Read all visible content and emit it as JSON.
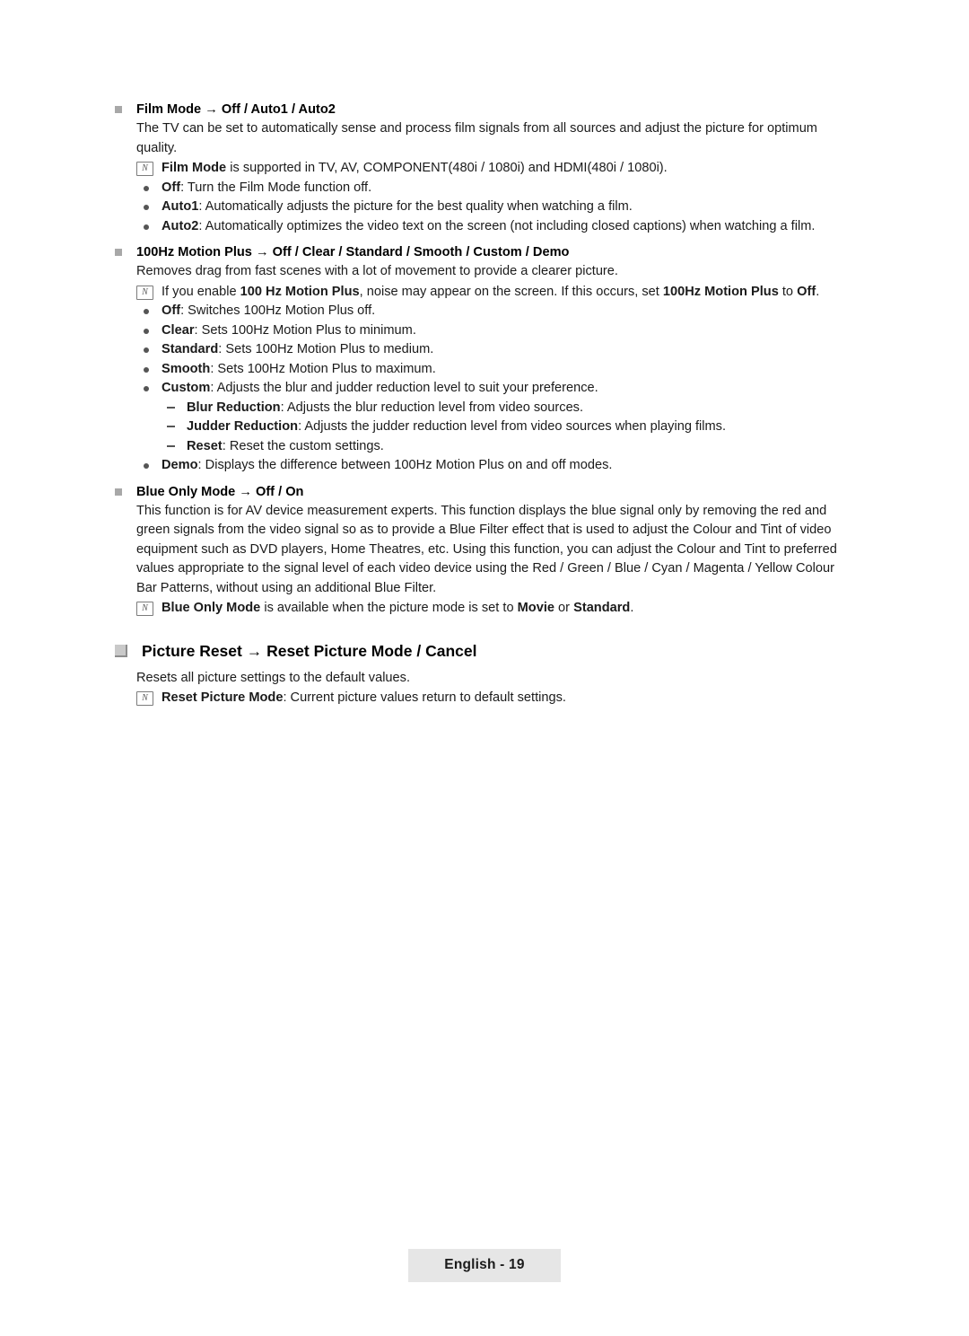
{
  "page": {
    "footer_label": "English - 19"
  },
  "sections": [
    {
      "heading_plain": "Film Mode ",
      "heading_arrow": "→",
      "heading_rest": " Off / Auto1 / Auto2",
      "intro": "The TV can be set to automatically sense and process film signals from all sources and adjust the picture for optimum quality.",
      "note": {
        "bold": "Film Mode",
        "rest": " is supported in TV, AV, COMPONENT(480i / 1080i) and HDMI(480i / 1080i)."
      },
      "bullets": [
        {
          "bold": "Off",
          "rest": ": Turn the Film Mode function off."
        },
        {
          "bold": "Auto1",
          "rest": ": Automatically adjusts the picture for the best quality when watching a film."
        },
        {
          "bold": "Auto2",
          "rest": ": Automatically optimizes the video text on the screen (not including closed captions) when watching a film."
        }
      ]
    }
  ],
  "section2": {
    "heading": "100Hz Motion Plus → Off / Clear / Standard / Smooth / Custom / Demo",
    "intro": "Removes drag from fast scenes with a lot of movement to provide a clearer picture.",
    "note_parts": {
      "p1": "If you enable ",
      "b1": "100 Hz Motion Plus",
      "p2": ", noise may appear on the screen. If this occurs, set ",
      "b2": "100Hz Motion Plus",
      "p3": " to ",
      "b3": "Off",
      "p4": "."
    },
    "bullets": [
      {
        "bold": "Off",
        "rest": ": Switches 100Hz Motion Plus off."
      },
      {
        "bold": "Clear",
        "rest": ": Sets 100Hz Motion Plus to minimum."
      },
      {
        "bold": "Standard",
        "rest": ": Sets 100Hz Motion Plus to medium."
      },
      {
        "bold": "Smooth",
        "rest": ": Sets 100Hz Motion Plus to maximum."
      },
      {
        "bold": "Custom",
        "rest": ": Adjusts the blur and judder reduction level to suit your preference."
      }
    ],
    "sub_bullets": [
      {
        "bold": "Blur Reduction",
        "rest": ": Adjusts the blur reduction level from video sources."
      },
      {
        "bold": "Judder Reduction",
        "rest": ": Adjusts the judder reduction level from video sources when playing films."
      },
      {
        "bold": "Reset",
        "rest": ": Reset the custom settings."
      }
    ],
    "last_bullet": {
      "bold": "Demo",
      "rest": ": Displays the difference between 100Hz Motion Plus on and off modes."
    }
  },
  "section3": {
    "heading": "Blue Only Mode → Off / On",
    "body": "This function is for AV device measurement experts. This function displays the blue signal only by removing the red and green signals from the video signal so as to provide a Blue Filter effect that is used to adjust the Colour and Tint of video equipment such as DVD players, Home Theatres, etc. Using this function, you can adjust the Colour and Tint to preferred values appropriate to the signal level of each video device using the Red / Green / Blue / Cyan / Magenta / Yellow Colour Bar Patterns, without using an additional Blue Filter.",
    "note_parts": {
      "b1": "Blue Only Mode",
      "p1": " is available when the picture mode is set to ",
      "b2": "Movie",
      "p2": " or ",
      "b3": "Standard",
      "p3": "."
    }
  },
  "section4": {
    "heading": "Picture Reset → Reset Picture Mode / Cancel",
    "body": "Resets all picture settings to the default values.",
    "note_parts": {
      "b1": "Reset Picture Mode",
      "p1": ": Current picture values return to default settings."
    }
  },
  "icons": {
    "note_glyph": "N"
  }
}
